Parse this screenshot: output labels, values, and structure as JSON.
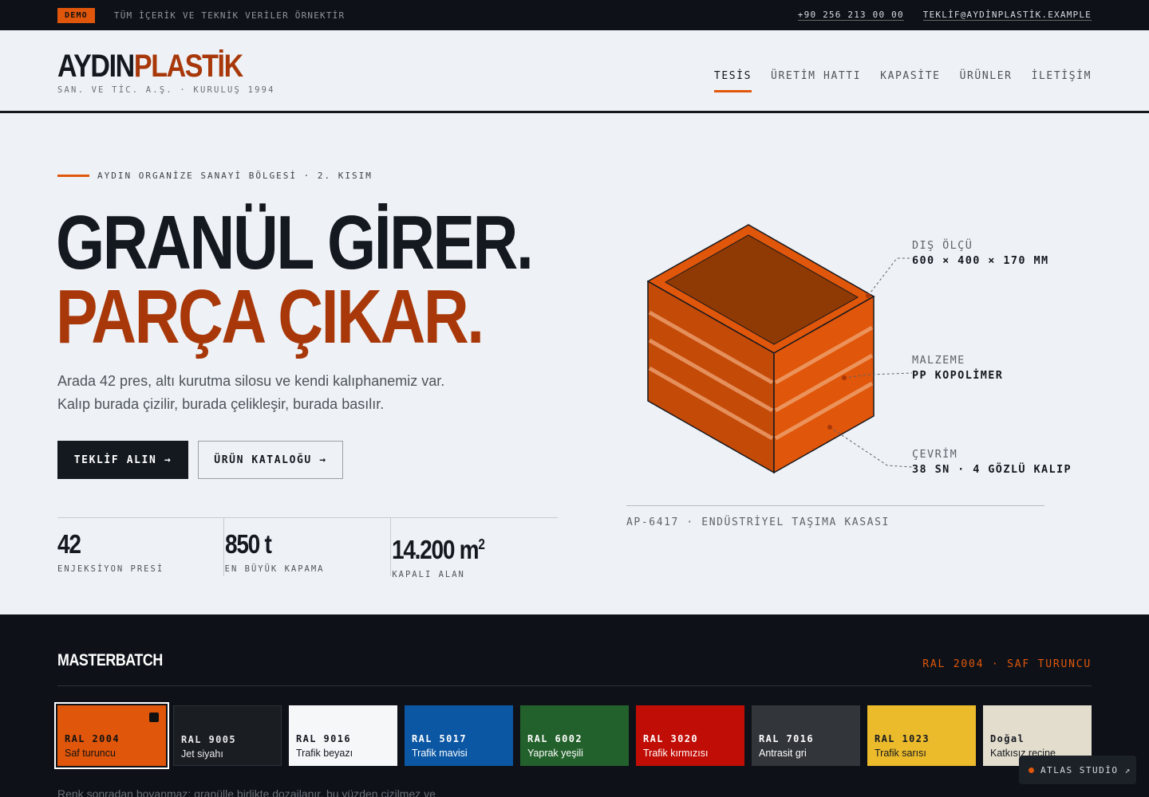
{
  "topbar": {
    "badge": "DEMO",
    "notice": "TÜM İÇERİK VE TEKNİK VERİLER ÖRNEKTİR",
    "phone": "+90 256 213 00 00",
    "email": "TEKLİF@AYDİNPLASTİK.EXAMPLE"
  },
  "header": {
    "logo_part1": "AYDIN",
    "logo_part2": "PLASTİK",
    "subtitle": "SAN. VE TİC. A.Ş. · KURULUŞ 1994",
    "nav": [
      {
        "label": "TESİS",
        "active": true
      },
      {
        "label": "ÜRETİM HATTI"
      },
      {
        "label": "KAPASİTE"
      },
      {
        "label": "ÜRÜNLER"
      },
      {
        "label": "İLETİŞİM"
      }
    ]
  },
  "hero": {
    "kicker": "AYDIN ORGANİZE SANAYİ BÖLGESİ · 2. KISIM",
    "title_line1": "GRANÜL GİRER.",
    "title_line2": "PARÇA ÇIKAR.",
    "lead_line1": "Arada 42 pres, altı kurutma silosu ve kendi kalıphanemiz var.",
    "lead_line2": "Kalıp burada çizilir, burada çelikleşir, burada basılır.",
    "cta_primary": "TEKLİF ALIN →",
    "cta_secondary": "ÜRÜN KATALOĞU →",
    "stats": [
      {
        "value": "42",
        "label": "ENJEKSİYON PRESİ"
      },
      {
        "value": "850 t",
        "label": "EN BÜYÜK KAPAMA"
      },
      {
        "value": "14.200 m",
        "sup": "2",
        "label": "KAPALI ALAN"
      }
    ]
  },
  "product": {
    "callouts": [
      {
        "key": "DIŞ ÖLÇÜ",
        "value": "600 × 400 × 170 MM"
      },
      {
        "key": "MALZEME",
        "value": "PP KOPOLİMER"
      },
      {
        "key": "ÇEVRİM",
        "value": "38 SN · 4 GÖZLÜ KALIP"
      }
    ],
    "caption": "AP-6417 · ENDÜSTRİYEL TAŞIMA KASASI",
    "colors": {
      "main": "#e0560a",
      "dark": "#c44a08",
      "top": "#8f3a04"
    }
  },
  "masterbatch": {
    "title": "MASTERBATCH",
    "selected": "RAL 2004 · SAF TURUNCU",
    "swatches": [
      {
        "code": "RAL 2004",
        "name": "Saf turuncu",
        "color": "#e0560a",
        "text": "#111111",
        "selected": true
      },
      {
        "code": "RAL 9005",
        "name": "Jet siyahı",
        "color": "#1a1d22",
        "text": "#e8eaed"
      },
      {
        "code": "RAL 9016",
        "name": "Trafik beyazı",
        "color": "#f5f7f9",
        "text": "#14181f"
      },
      {
        "code": "RAL 5017",
        "name": "Trafik mavisi",
        "color": "#0b57a4",
        "text": "#ffffff"
      },
      {
        "code": "RAL 6002",
        "name": "Yaprak yeşili",
        "color": "#23612c",
        "text": "#ffffff"
      },
      {
        "code": "RAL 3020",
        "name": "Trafik kırmızısı",
        "color": "#c00d05",
        "text": "#ffffff"
      },
      {
        "code": "RAL 7016",
        "name": "Antrasit gri",
        "color": "#32363b",
        "text": "#ffffff"
      },
      {
        "code": "RAL 1023",
        "name": "Trafik sarısı",
        "color": "#ecbb2c",
        "text": "#14181f"
      },
      {
        "code": "Doğal",
        "name": "Katkısız reçine",
        "color": "#e3ddcd",
        "text": "#14181f"
      }
    ],
    "note": "Renk sonradan boyanmaz; granülle birlikte dozajlanır, bu yüzden çizilmez ve"
  },
  "badge": {
    "label": "ATLAS STUDİO ↗"
  }
}
